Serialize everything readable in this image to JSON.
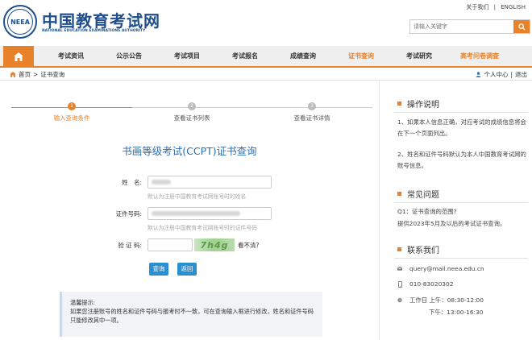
{
  "header": {
    "logo_seal_text": "NEEA",
    "logo_cn": "中国教育考试网",
    "logo_en": "NATIONAL EDUCATION EXAMINATIONS AUTHORITY",
    "about": "关于我们",
    "separator": "|",
    "english": "ENGLISH",
    "search_placeholder": "请输入关键字"
  },
  "nav": {
    "items": [
      "考试资讯",
      "公示公告",
      "考试项目",
      "考试报名",
      "成绩查询",
      "证书查询",
      "考试研究",
      "高考问卷调查"
    ],
    "active_index": 5,
    "accent_color": "#e8822a"
  },
  "breadcrumb": {
    "home": "首页",
    "sep": ">",
    "current": "证书查询",
    "user_center": "个人中心",
    "divider": "|",
    "logout": "退出"
  },
  "steps": [
    {
      "num": "1",
      "label": "输入查询条件"
    },
    {
      "num": "2",
      "label": "查看证书列表"
    },
    {
      "num": "3",
      "label": "查看证书详情"
    }
  ],
  "form": {
    "title": "书画等级考试(CCPT)证书查询",
    "name_label": "姓　名:",
    "name_hint": "默认为注册中国教育考试网账号时的姓名",
    "id_label": "证件号码:",
    "id_hint": "默认为注册中国教育考试网账号时的证件号码",
    "captcha_label": "验 证 码:",
    "captcha_text": "7h4g",
    "captcha_refresh": "看不清?",
    "query_button": "查询",
    "back_button": "返回"
  },
  "notice": {
    "title": "温馨提示:",
    "body": "如果您注册账号的姓名和证件号码与报考时不一致，可在查询输入框进行修改，姓名和证件号码只能修改其中一项。"
  },
  "sidebar": {
    "ops_title": "操作说明",
    "ops_text_1": "1、如果本人信息正确，对应考试的成绩信息将会在下一个页面列出。",
    "ops_text_2": "2、姓名和证件号码默认为本人中国教育考试网的账号信息。",
    "faq_title": "常见问题",
    "faq_q": "Q1：证书查询的范围?",
    "faq_a": "提供2023年5月及以后的考试证书查询。",
    "contact_title": "联系我们",
    "email": "query@mail.neea.edu.cn",
    "phone": "010-83020302",
    "hours_am": "工作日 上午：08:30-12:00",
    "hours_pm": "下午：13:00-16:30"
  }
}
